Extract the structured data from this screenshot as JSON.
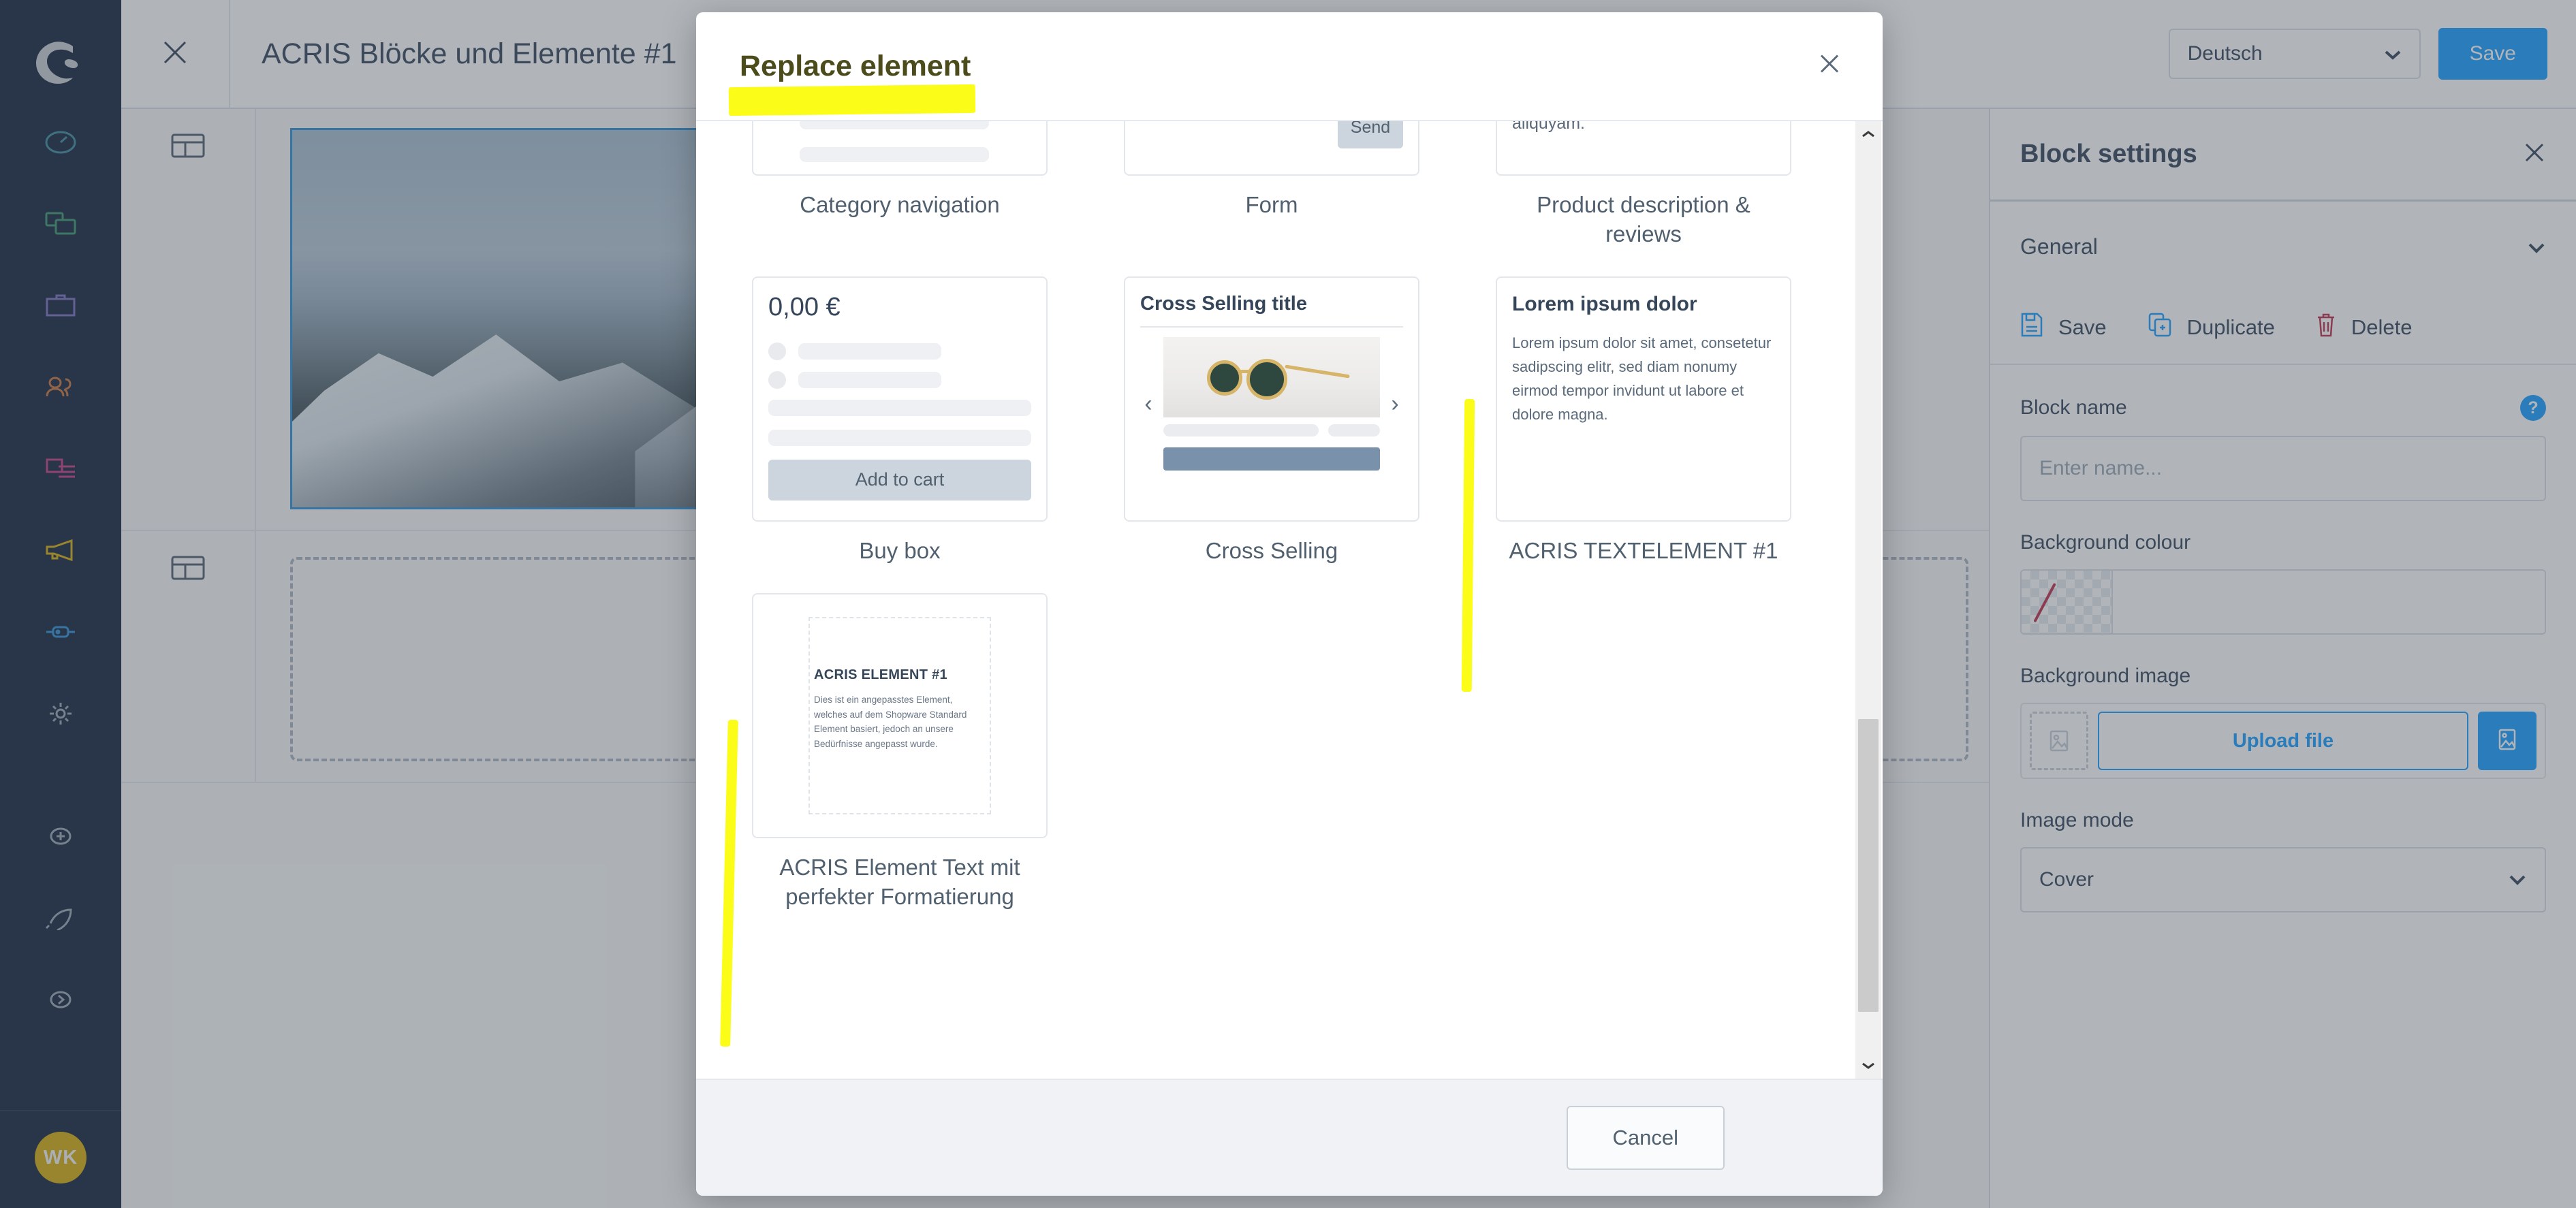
{
  "app": {
    "brand_logo": "shopware-logo-icon",
    "avatar_initials": "WK",
    "nav_items": [
      {
        "name": "dashboard",
        "icon": "speedometer-icon",
        "color": "#3d8a9e"
      },
      {
        "name": "catalogues",
        "icon": "copy-windows-icon",
        "color": "#3a9469"
      },
      {
        "name": "orders",
        "icon": "briefcase-icon",
        "color": "#7a6fc0"
      },
      {
        "name": "customers",
        "icon": "users-icon",
        "color": "#c5743b"
      },
      {
        "name": "content",
        "icon": "content-layout-icon",
        "color": "#c33d82"
      },
      {
        "name": "marketing",
        "icon": "megaphone-icon",
        "color": "#d4ac0d"
      },
      {
        "name": "extensions",
        "icon": "plug-icon",
        "color": "#2e8fd6"
      },
      {
        "name": "settings",
        "icon": "gear-icon",
        "color": "#9aa6b4"
      },
      {
        "name": "add",
        "icon": "plus-circle-icon",
        "color": "#9aa6b4"
      },
      {
        "name": "whats-new",
        "icon": "rocket-icon",
        "color": "#9aa6b4"
      },
      {
        "name": "expand",
        "icon": "chevron-right-circle-icon",
        "color": "#9aa6b4"
      }
    ]
  },
  "topbar": {
    "close_icon": "close-icon",
    "title": "ACRIS Blöcke und Elemente #1",
    "device_buttons": [
      {
        "name": "mobile",
        "icon": "mobile-icon",
        "active": false
      },
      {
        "name": "tablet-portrait",
        "icon": "tablet-icon",
        "active": false
      },
      {
        "name": "desktop",
        "icon": "desktop-icon",
        "active": true
      },
      {
        "name": "tablet-landscape",
        "icon": "tablet-landscape-icon",
        "active": false
      }
    ],
    "language": "Deutsch",
    "language_caret": "chevron-down-icon",
    "save_label": "Save",
    "save_color": "#189eff"
  },
  "canvas": {
    "section_icon": "layout-block-icon",
    "hero_alt": "snow-covered-mountain-photo",
    "empty_dropzone": ""
  },
  "settings_panel": {
    "title": "Block settings",
    "close_icon": "close-icon",
    "general_label": "General",
    "general_caret": "chevron-down-icon",
    "actions": [
      {
        "label": "Save",
        "icon": "save-disk-icon",
        "color": "#189eff"
      },
      {
        "label": "Duplicate",
        "icon": "duplicate-icon",
        "color": "#189eff"
      },
      {
        "label": "Delete",
        "icon": "trash-icon",
        "color": "#c0304a"
      }
    ],
    "block_name_label": "Block name",
    "block_name_help_icon": "question-mark-icon",
    "block_name_value": "",
    "block_name_placeholder": "Enter name...",
    "background_colour_label": "Background colour",
    "background_colour_value": "",
    "background_colour_swatch": "transparent-no-colour-icon",
    "background_image_label": "Background image",
    "background_image_thumb_icon": "image-placeholder-icon",
    "upload_file_label": "Upload file",
    "media_button_icon": "image-icon",
    "image_mode_label": "Image mode",
    "image_mode_value": "Cover",
    "image_mode_caret": "chevron-down-icon"
  },
  "modal": {
    "title": "Replace element",
    "title_highlight_colour": "#fbfd19",
    "close_icon": "close-icon",
    "cancel_label": "Cancel",
    "scrollbar": {
      "up_icon": "chevron-up-icon",
      "down_icon": "chevron-down-icon"
    },
    "tiles": [
      {
        "id": "category-navigation",
        "label": "Category navigation",
        "preview_type": "skeleton-nav"
      },
      {
        "id": "form",
        "label": "Form",
        "preview_type": "form",
        "send_label": "Send"
      },
      {
        "id": "product-description-reviews",
        "label": "Product description & reviews",
        "preview_type": "text",
        "body": "sed diam nonumy eirmod tempor invidunt ut labore et dolore magna aliquyam."
      },
      {
        "id": "buy-box",
        "label": "Buy box",
        "preview_type": "buybox",
        "price": "0,00 €",
        "cart_label": "Add to cart"
      },
      {
        "id": "cross-selling",
        "label": "Cross Selling",
        "preview_type": "crossell",
        "cs_title": "Cross Selling title",
        "prev_icon": "chevron-left-icon",
        "next_icon": "chevron-right-icon",
        "photo_alt": "round-gold-sunglasses-photo"
      },
      {
        "id": "acris-textelement-1",
        "label": "ACRIS TEXTELEMENT #1",
        "preview_type": "acris-text",
        "heading": "Lorem ipsum dolor",
        "body": "Lorem ipsum dolor sit amet, consetetur sadipscing elitr, sed diam nonumy eirmod tempor invidunt ut labore et dolore magna."
      },
      {
        "id": "acris-element-text",
        "label": "ACRIS Element Text mit perfekter Formatierung",
        "preview_type": "acris-element",
        "heading": "ACRIS ELEMENT #1",
        "body": "Dies ist ein angepasstes Element, welches auf dem Shopware Standard Element basiert, jedoch an unsere Bedürfnisse angepasst wurde."
      }
    ]
  },
  "annotations": {
    "highlight_colour": "#fbfd19",
    "strokes": [
      "title-highlight",
      "acris-textelement-marker",
      "acris-element-text-marker"
    ]
  }
}
